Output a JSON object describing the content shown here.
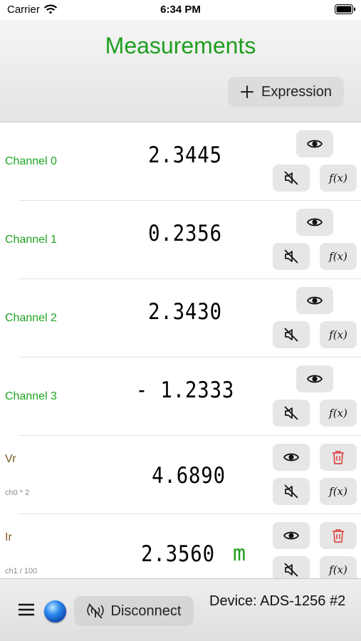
{
  "status_bar": {
    "carrier": "Carrier",
    "time": "6:34 PM"
  },
  "header": {
    "title": "Measurements",
    "add_expression_label": "Expression"
  },
  "rows": [
    {
      "label": "Channel 0",
      "value": "2.3445"
    },
    {
      "label": "Channel 1",
      "value": "0.2356"
    },
    {
      "label": "Channel 2",
      "value": "2.3430"
    },
    {
      "label": "Channel 3",
      "value": "- 1.2333"
    },
    {
      "label": "Vr",
      "formula": "ch0 * 2",
      "value": "4.6890"
    },
    {
      "label": "Ir",
      "formula": "ch1 / 100",
      "value": "2.3560",
      "unit": "m"
    }
  ],
  "fx_label": "f(x)",
  "toolbar": {
    "disconnect_label": "Disconnect",
    "device": "Device: ADS-1256 #2"
  },
  "colors": {
    "channel": "#1fa51f",
    "expression": "#7a5a25",
    "delete": "#e04848"
  }
}
